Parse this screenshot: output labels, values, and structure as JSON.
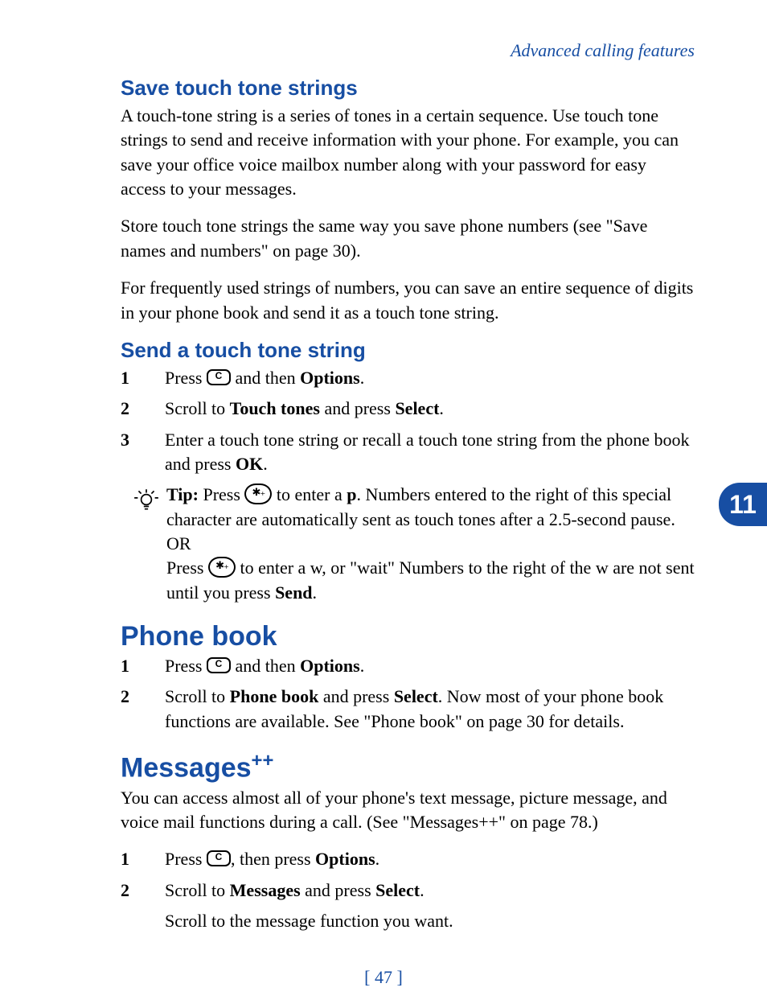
{
  "running_head": "Advanced calling features",
  "side_tab": "11",
  "folio": "[ 47 ]",
  "section1": {
    "heading": "Save touch tone strings",
    "para1": "A touch-tone string is a series of tones in a certain sequence. Use touch tone strings to send and receive information with your phone. For example, you can save your office voice mailbox number along with your password for easy access to your messages.",
    "para2": "Store touch tone strings the same way you save phone numbers (see \"Save names and numbers\" on page 30).",
    "para3": "For frequently used strings of numbers, you can save an entire sequence of digits in your phone book and send it as a touch tone string."
  },
  "section2": {
    "heading": "Send a touch tone string",
    "step1_a": "Press ",
    "step1_b": " and then ",
    "step1_c": "Options",
    "step1_d": ".",
    "step2_a": "Scroll to ",
    "step2_b": "Touch tones",
    "step2_c": " and press ",
    "step2_d": "Select",
    "step2_e": ".",
    "step3_a": "Enter a touch tone string or recall a touch tone string from the phone book and press ",
    "step3_b": "OK",
    "step3_c": ".",
    "tip_label": "Tip:",
    "tip_a": " Press  ",
    "tip_b": "  to enter a ",
    "tip_c": "p",
    "tip_d": ". Numbers entered to the right of this special character are automatically sent as touch tones after a 2.5-second pause.",
    "tip_or": "OR",
    "tip_e": "Press  ",
    "tip_f": "  to enter a w, or \"wait\" Numbers to the right of the w are not sent until you press ",
    "tip_g": "Send",
    "tip_h": "."
  },
  "section3": {
    "heading": "Phone book",
    "step1_a": "Press ",
    "step1_b": " and then ",
    "step1_c": "Options",
    "step1_d": ".",
    "step2_a": "Scroll to ",
    "step2_b": "Phone book",
    "step2_c": " and press ",
    "step2_d": "Select",
    "step2_e": ". Now most of your phone book functions are available. See \"Phone book\" on page 30 for details."
  },
  "section4": {
    "heading": "Messages",
    "heading_sup": "++",
    "para": "You can access almost all of your phone's text message, picture message, and voice mail functions during a call. (See \"Messages++\" on page 78.)",
    "step1_a": "Press ",
    "step1_b": ", then press ",
    "step1_c": "Options",
    "step1_d": ".",
    "step2_a": "Scroll to ",
    "step2_b": "Messages",
    "step2_c": " and press ",
    "step2_d": "Select",
    "step2_e": ".",
    "tail": "Scroll to the message function you want."
  }
}
